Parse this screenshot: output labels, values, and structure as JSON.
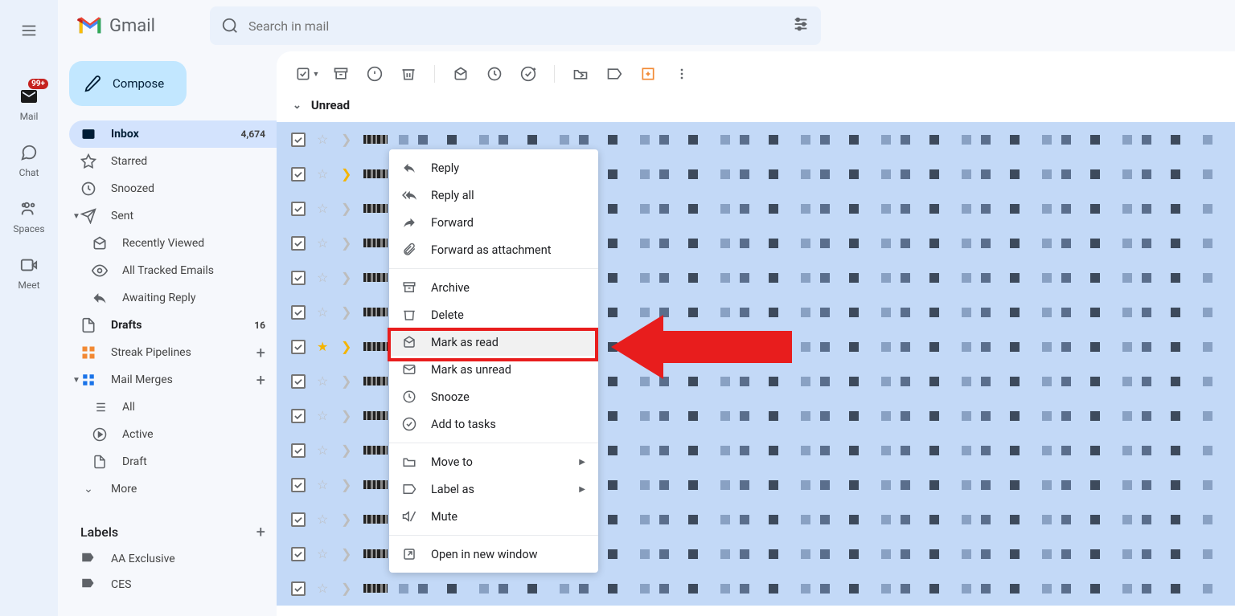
{
  "header": {
    "logo_text": "Gmail",
    "search_placeholder": "Search in mail"
  },
  "rail": {
    "mail": "Mail",
    "mail_badge": "99+",
    "chat": "Chat",
    "spaces": "Spaces",
    "meet": "Meet"
  },
  "sidebar": {
    "compose": "Compose",
    "items": {
      "inbox": "Inbox",
      "inbox_count": "4,674",
      "starred": "Starred",
      "snoozed": "Snoozed",
      "sent": "Sent",
      "recently_viewed": "Recently Viewed",
      "all_tracked": "All Tracked Emails",
      "awaiting_reply": "Awaiting Reply",
      "drafts": "Drafts",
      "drafts_count": "16",
      "streak": "Streak Pipelines",
      "mail_merges": "Mail Merges",
      "all": "All",
      "active": "Active",
      "draft": "Draft",
      "more": "More"
    },
    "labels_header": "Labels",
    "labels": {
      "aa": "AA Exclusive",
      "ces": "CES"
    }
  },
  "main": {
    "section": "Unread"
  },
  "context_menu": {
    "reply": "Reply",
    "reply_all": "Reply all",
    "forward": "Forward",
    "forward_attach": "Forward as attachment",
    "archive": "Archive",
    "delete": "Delete",
    "mark_read": "Mark as read",
    "mark_unread": "Mark as unread",
    "snooze": "Snooze",
    "add_tasks": "Add to tasks",
    "move_to": "Move to",
    "label_as": "Label as",
    "mute": "Mute",
    "open_window": "Open in new window"
  }
}
